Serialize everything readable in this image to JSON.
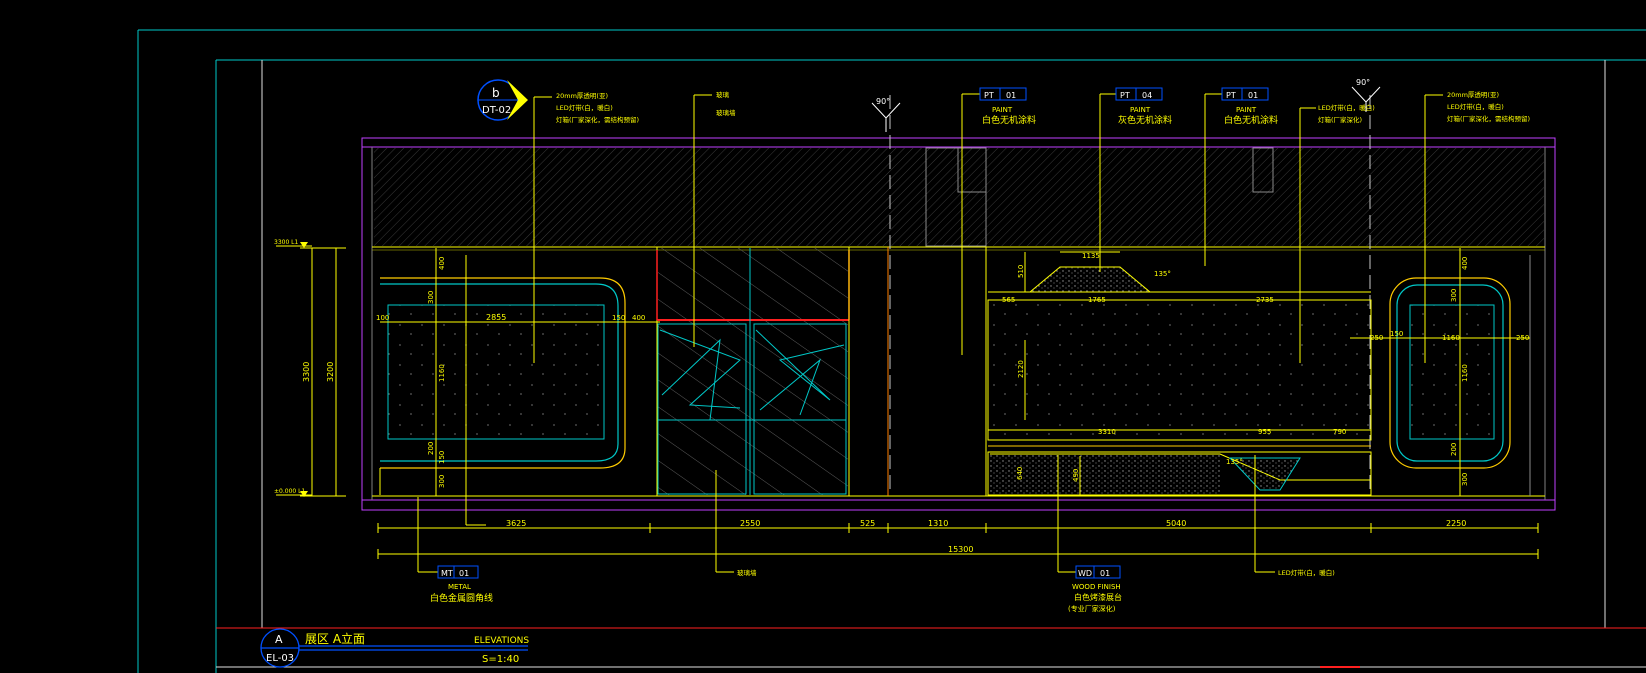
{
  "drawing": {
    "title_cn": "展区 A立面",
    "title_en": "ELEVATIONS",
    "scale": "S=1:40",
    "id_letter": "A",
    "id_sheet": "EL-03",
    "section_ref_letter": "b",
    "section_ref_sheet": "DT-02",
    "angle_mark": "90°"
  },
  "tags": {
    "pt01_a": {
      "code": "PT",
      "num": "01",
      "en": "PAINT",
      "cn": "白色无机涂料"
    },
    "pt04": {
      "code": "PT",
      "num": "04",
      "en": "PAINT",
      "cn": "灰色无机涂料"
    },
    "pt01_b": {
      "code": "PT",
      "num": "01",
      "en": "PAINT",
      "cn": "白色无机涂料"
    },
    "mt01": {
      "code": "MT",
      "num": "01",
      "en": "METAL",
      "cn": "白色金属圆角线"
    },
    "wd01": {
      "code": "WD",
      "num": "01",
      "en": "WOOD FINISH",
      "cn": "白色烤漆展台",
      "note": "(专业厂家深化)"
    }
  },
  "notes": {
    "left_panel": [
      "20mm厚透明(亚)",
      "LED灯带(白，暖白)",
      "灯箱(厂家深化，需结构预留)"
    ],
    "glass": [
      "玻璃",
      "玻璃墙"
    ],
    "led_right": [
      "LED灯带(白，暖白)",
      "灯箱(厂家深化)"
    ],
    "right_panel": [
      "20mm厚透明(亚)",
      "LED灯带(白，暖白)",
      "灯箱(厂家深化，需结构预留)"
    ],
    "bottom_glass": "玻璃墙",
    "bottom_led": "LED灯带(白，暖白)"
  },
  "levels": {
    "top": "3300 L1",
    "bottom": "±0.000 L1"
  },
  "dimensions": {
    "overall_h_a": "3300",
    "overall_h_b": "3200",
    "bottom_row": [
      "3625",
      "2550",
      "525",
      "1310",
      "5040",
      "2250"
    ],
    "total": "15300",
    "left": {
      "w": "2855",
      "top": "400",
      "r1": "300",
      "h": "1160",
      "b1": "200",
      "b2": "150",
      "b3": "300",
      "s1": "150",
      "s2": "400",
      "side": "100"
    },
    "center": {
      "d1": "1135",
      "d2": "510",
      "d3": "565",
      "d4": "1765",
      "d5": "2735",
      "d6": "2120",
      "d7": "3310",
      "d8": "955",
      "d9": "790",
      "d10": "640",
      "d11": "490",
      "ang1": "135°",
      "ang2": "135°"
    },
    "right": {
      "w": "1160",
      "top": "400",
      "r1": "300",
      "h": "1160",
      "b1": "200",
      "b2": "300",
      "s1": "250",
      "s2": "150",
      "s3": "250"
    }
  }
}
